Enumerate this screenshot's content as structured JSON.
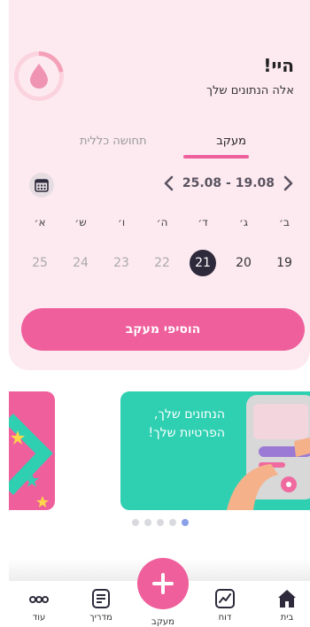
{
  "header": {
    "title": "היי!",
    "subtitle": "אלה הנתונים שלך"
  },
  "tabs": [
    {
      "label": "מעקב",
      "active": true
    },
    {
      "label": "תחושה כללית",
      "active": false
    }
  ],
  "date_range": "25.08 - 19.08",
  "days": [
    {
      "name": "ב׳",
      "num": "19"
    },
    {
      "name": "ג׳",
      "num": "20"
    },
    {
      "name": "ד׳",
      "num": "21",
      "selected": true
    },
    {
      "name": "ה׳",
      "num": "22"
    },
    {
      "name": "ו׳",
      "num": "23"
    },
    {
      "name": "ש׳",
      "num": "24"
    },
    {
      "name": "א׳",
      "num": "25"
    }
  ],
  "add_button_label": "הוסיפי מעקב",
  "carousel": {
    "slide_text": "הנתונים שלך, הפרטיות שלך!",
    "dot_count": 5,
    "active_dot": 4
  },
  "nav": {
    "home": "בית",
    "report": "דוח",
    "track": "מעקב",
    "guide": "מדריך",
    "more": "עוד"
  },
  "colors": {
    "accent": "#ee5f9c",
    "card_bg": "#fdeaf0",
    "teal": "#2fd0b2",
    "selected_day": "#2e2a3b"
  },
  "icons": [
    "drop-icon",
    "calendar-icon",
    "chevron-left-icon",
    "chevron-right-icon",
    "plus-icon",
    "home-icon",
    "chart-icon",
    "guide-icon",
    "more-icon"
  ]
}
